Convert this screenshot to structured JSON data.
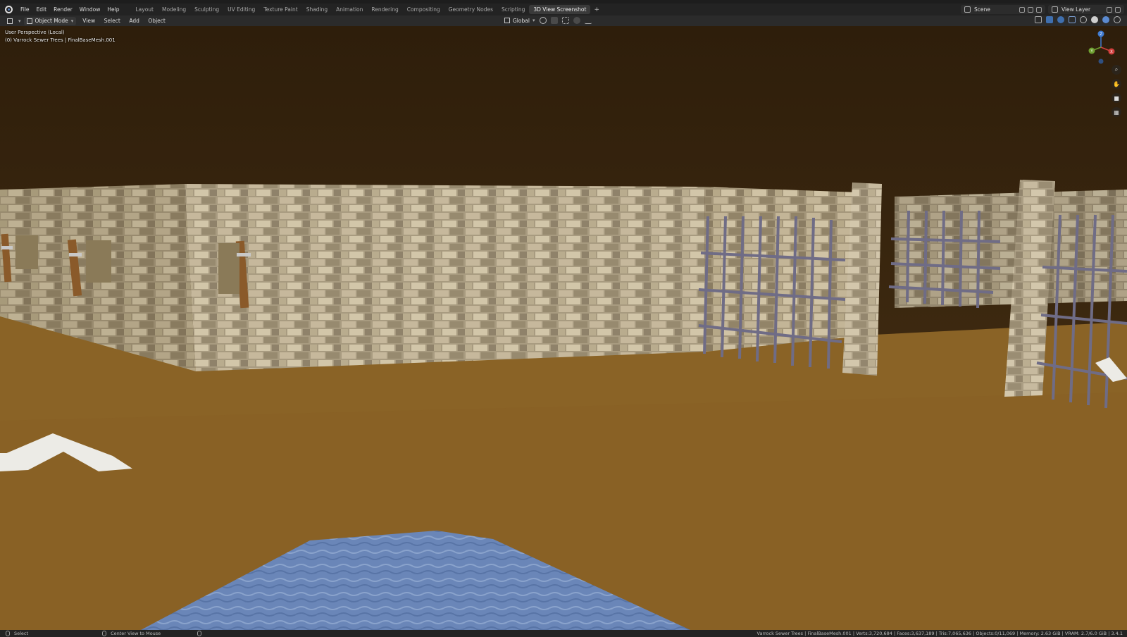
{
  "topbar": {
    "menus": [
      "File",
      "Edit",
      "Render",
      "Window",
      "Help"
    ],
    "workspaces": [
      "Layout",
      "Modeling",
      "Sculpting",
      "UV Editing",
      "Texture Paint",
      "Shading",
      "Animation",
      "Rendering",
      "Compositing",
      "Geometry Nodes",
      "Scripting",
      "3D View Screenshot"
    ],
    "active_workspace": "3D View Screenshot",
    "add_workspace": "+",
    "scene_label": "Scene",
    "view_layer_label": "View Layer"
  },
  "viewport_header": {
    "mode": "Object Mode",
    "menus": [
      "View",
      "Select",
      "Add",
      "Object"
    ],
    "orientation": "Global"
  },
  "viewport": {
    "perspective_label": "User Perspective (Local)",
    "object_label": "(0) Varrock Sewer Trees | FinalBaseMesh.001",
    "gizmo_axes": {
      "z": "Z",
      "x": "X",
      "y": "Y"
    },
    "colors": {
      "sky": "#3a2610",
      "floor": "#8a6326",
      "wall": "#a89a80",
      "water": "#6a86b8",
      "fence": "#6f6c86",
      "axis_x": "#d2403f",
      "axis_y": "#6fa031",
      "axis_z": "#3f7ad0"
    }
  },
  "statusbar": {
    "left_action": "Select",
    "middle_action": "Center View to Mouse",
    "stats": "Varrock Sewer Trees | FinalBaseMesh.001 | Verts:3,720,684 | Faces:3,637,189 | Tris:7,065,636 | Objects:0/11,069 | Memory: 2.63 GiB | VRAM: 2.7/6.0 GiB | 3.4.1"
  }
}
